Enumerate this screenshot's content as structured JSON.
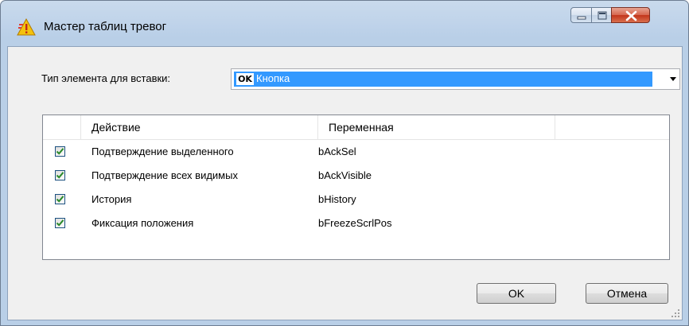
{
  "window": {
    "title": "Мастер таблиц тревог",
    "icon": "alarm-warning-icon",
    "controls": [
      "minimize-icon",
      "maximize-icon",
      "close-icon"
    ]
  },
  "insert_type": {
    "label": "Тип элемента для вставки:",
    "badge": "OK",
    "selected": "Кнопка"
  },
  "table": {
    "columns": [
      "",
      "Действие",
      "Переменная",
      ""
    ],
    "rows": [
      {
        "checked": true,
        "action": "Подтверждение выделенного",
        "variable": "bAckSel"
      },
      {
        "checked": true,
        "action": "Подтверждение всех видимых",
        "variable": "bAckVisible"
      },
      {
        "checked": true,
        "action": "История",
        "variable": "bHistory"
      },
      {
        "checked": true,
        "action": "Фиксация положения",
        "variable": "bFreezeScrlPos"
      }
    ]
  },
  "buttons": {
    "ok": "OK",
    "cancel": "Отмена"
  },
  "colors": {
    "selection": "#3399ff",
    "checkmark": "#2b8a2b",
    "titlebar": "#c4d8ee",
    "close_button": "#c7432a"
  }
}
